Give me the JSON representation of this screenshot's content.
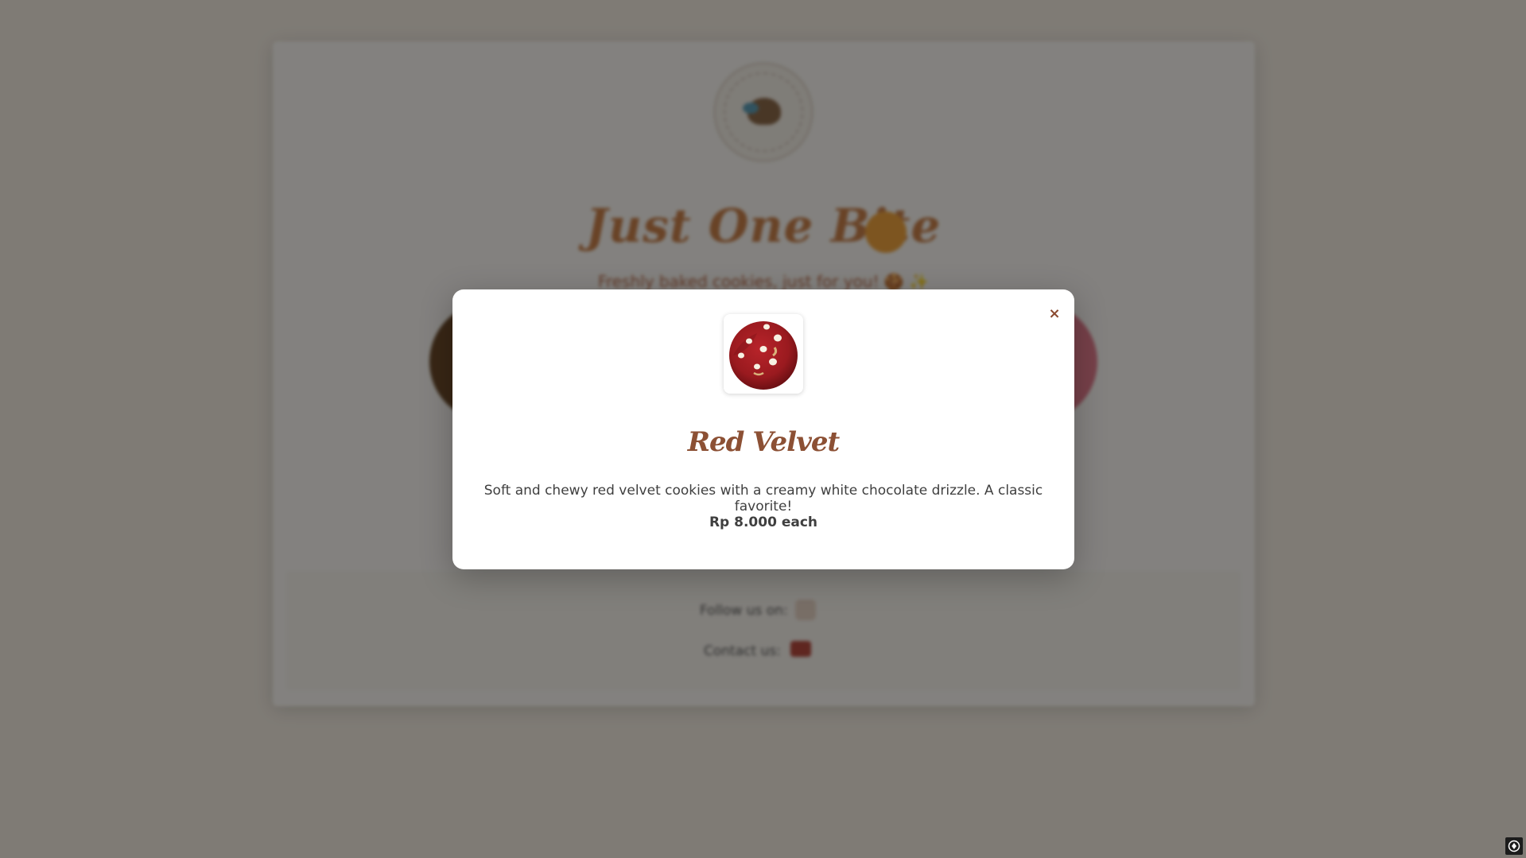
{
  "background": {
    "title": "Just One Bite",
    "subtitle": "Freshly baked cookies, just for you! 🍪 ✨",
    "footer": {
      "follow_label": "Follow us on:",
      "contact_label": "Contact us:"
    }
  },
  "modal": {
    "close_label": "×",
    "product_name": "Red Velvet",
    "description": "Soft and chewy red velvet cookies with a creamy white chocolate drizzle. A classic favorite!",
    "price": "Rp 8.000 each"
  },
  "colors": {
    "accent": "#8c5034",
    "overlay": "rgba(0,0,0,0.48)",
    "cookie": "#a31c1f"
  }
}
